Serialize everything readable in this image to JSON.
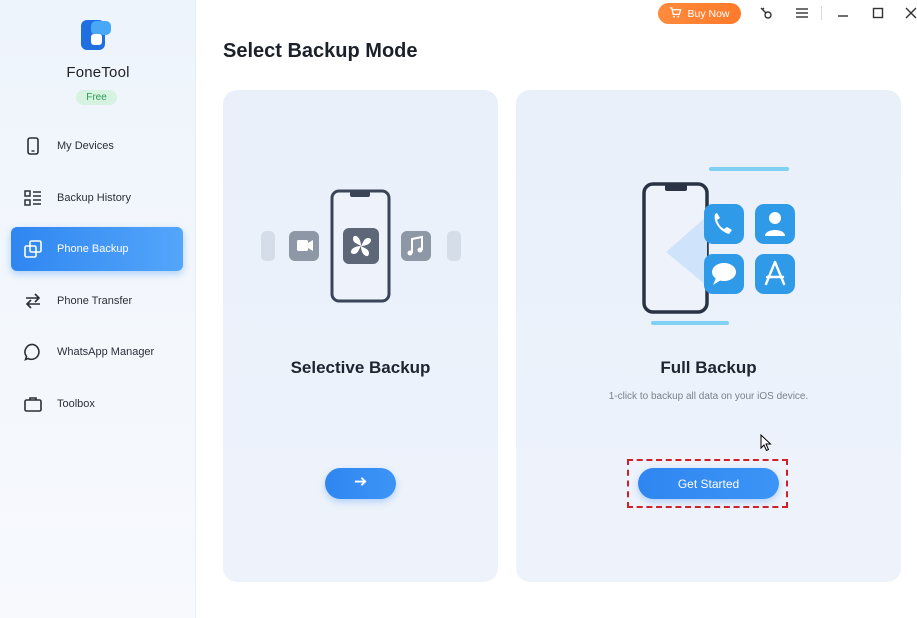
{
  "app": {
    "name": "FoneTool",
    "badge": "Free"
  },
  "titlebar": {
    "buy_now": "Buy Now"
  },
  "sidebar": {
    "items": [
      {
        "label": "My Devices",
        "icon": "phone-icon",
        "active": false
      },
      {
        "label": "Backup History",
        "icon": "list-icon",
        "active": false
      },
      {
        "label": "Phone Backup",
        "icon": "backup-icon",
        "active": true
      },
      {
        "label": "Phone Transfer",
        "icon": "transfer-arrows-icon",
        "active": false
      },
      {
        "label": "WhatsApp Manager",
        "icon": "chat-bubble-icon",
        "active": false
      },
      {
        "label": "Toolbox",
        "icon": "toolbox-icon",
        "active": false
      }
    ]
  },
  "main": {
    "title": "Select Backup Mode",
    "cards": [
      {
        "title": "Selective Backup",
        "description": "",
        "button": ""
      },
      {
        "title": "Full Backup",
        "description": "1-click to backup all data on your iOS device.",
        "button": "Get Started"
      }
    ]
  },
  "colors": {
    "accent": "#2f86f0",
    "buy_now": "#ff7a2a",
    "highlight": "#d0202a",
    "free_badge": "#d6f2e0"
  }
}
